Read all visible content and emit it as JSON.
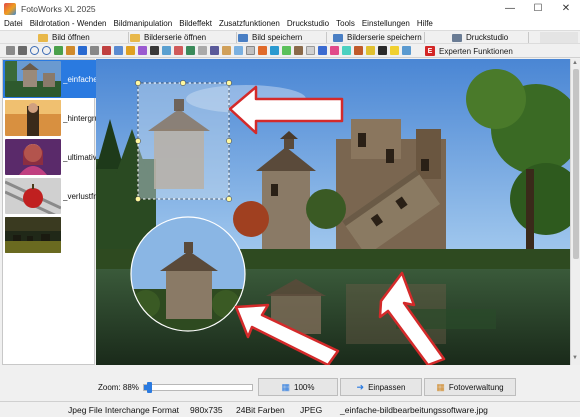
{
  "window": {
    "title": "FotoWorks XL 2025"
  },
  "menu": [
    "Datei",
    "Bildrotation - Wenden",
    "Bildmanipulation",
    "Bildeffekt",
    "Zusatzfunktionen",
    "Druckstudio",
    "Tools",
    "Einstellungen",
    "Hilfe"
  ],
  "toolbar": {
    "open_image": "Bild öffnen",
    "open_series": "Bilderserie öffnen",
    "save_image": "Bild speichern",
    "save_series": "Bilderserie speichern",
    "print_studio": "Druckstudio",
    "expert_functions": "Experten Funktionen"
  },
  "thumbnails": [
    {
      "label": "_einfache-",
      "selected": true
    },
    {
      "label": "_hintergru",
      "selected": false
    },
    {
      "label": "_ultimative",
      "selected": false
    },
    {
      "label": "_verlustfre",
      "selected": false
    }
  ],
  "zoom": {
    "label": "Zoom: 88%",
    "level": 0.05
  },
  "buttons": {
    "percent100": "100%",
    "fit": "Einpassen",
    "photo_manager": "Fotoverwaltung"
  },
  "status": {
    "format": "Jpeg File Interchange Format",
    "dimensions": "980x735",
    "colors": "24Bit Farben",
    "type": "JPEG",
    "filename": "_einfache-bildbearbeitungssoftware.jpg"
  }
}
